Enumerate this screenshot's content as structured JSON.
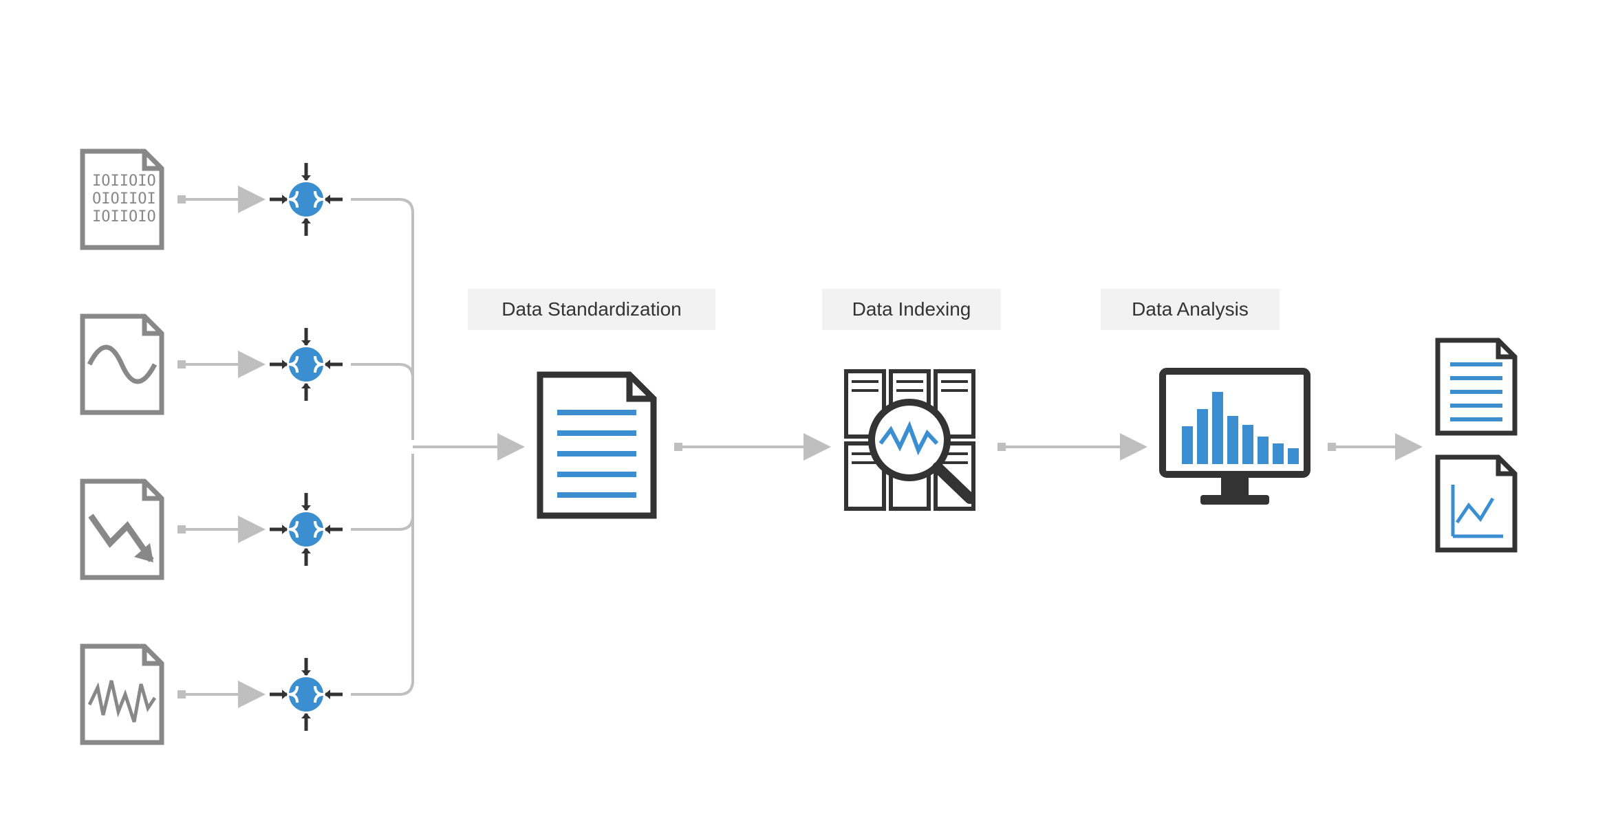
{
  "stages": {
    "standardization": "Data Standardization",
    "indexing": "Data Indexing",
    "analysis": "Data Analysis"
  },
  "binary_text_lines": [
    "IOIIOIO",
    "OIOIIOI",
    "IOIIOIO"
  ],
  "colors": {
    "accent": "#3b8fd0",
    "dark": "#333333",
    "mid": "#888888",
    "light_gray": "#bfbfbf",
    "label_bg": "#f2f2f2"
  },
  "flow": {
    "sources": [
      "binary-data",
      "waveform",
      "trend-chart",
      "signal"
    ],
    "stages": [
      "standardization",
      "indexing",
      "analysis"
    ],
    "outputs": [
      "text-report",
      "chart-report"
    ]
  }
}
